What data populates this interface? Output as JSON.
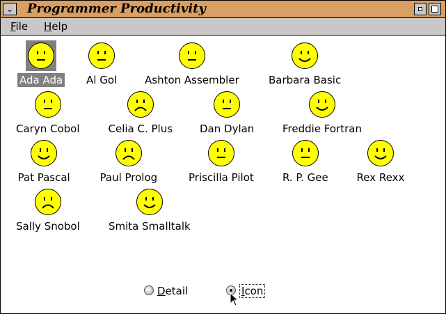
{
  "window": {
    "title": "Programmer Productivity",
    "sysmenu_glyph": "⌄"
  },
  "menubar": {
    "file": {
      "accel": "F",
      "rest": "ile"
    },
    "help": {
      "accel": "H",
      "rest": "elp"
    }
  },
  "programmers": [
    {
      "name": "Ada Ada",
      "mood": "neutral",
      "selected": true
    },
    {
      "name": "Al Gol",
      "mood": "neutral",
      "selected": false
    },
    {
      "name": "Ashton Assembler",
      "mood": "neutral",
      "selected": false
    },
    {
      "name": "Barbara Basic",
      "mood": "happy",
      "selected": false
    },
    {
      "name": "Caryn Cobol",
      "mood": "neutral",
      "selected": false
    },
    {
      "name": "Celia C. Plus",
      "mood": "sad",
      "selected": false
    },
    {
      "name": "Dan Dylan",
      "mood": "neutral",
      "selected": false
    },
    {
      "name": "Freddie Fortran",
      "mood": "happy",
      "selected": false
    },
    {
      "name": "Pat Pascal",
      "mood": "happy",
      "selected": false
    },
    {
      "name": "Paul Prolog",
      "mood": "sad",
      "selected": false
    },
    {
      "name": "Priscilla Pilot",
      "mood": "neutral",
      "selected": false
    },
    {
      "name": "R. P. Gee",
      "mood": "neutral",
      "selected": false
    },
    {
      "name": "Rex Rexx",
      "mood": "happy",
      "selected": false
    },
    {
      "name": "Sally Snobol",
      "mood": "sad",
      "selected": false
    },
    {
      "name": "Smita Smalltalk",
      "mood": "happy",
      "selected": false
    }
  ],
  "view_options": {
    "detail": {
      "accel": "D",
      "rest": "etail",
      "checked": false
    },
    "icon": {
      "accel": "I",
      "rest": "con",
      "checked": true
    }
  },
  "colors": {
    "titlebar": "#d99f63",
    "face": "#ffff00",
    "selection": "#808080",
    "menubar": "#c8c8c8"
  }
}
